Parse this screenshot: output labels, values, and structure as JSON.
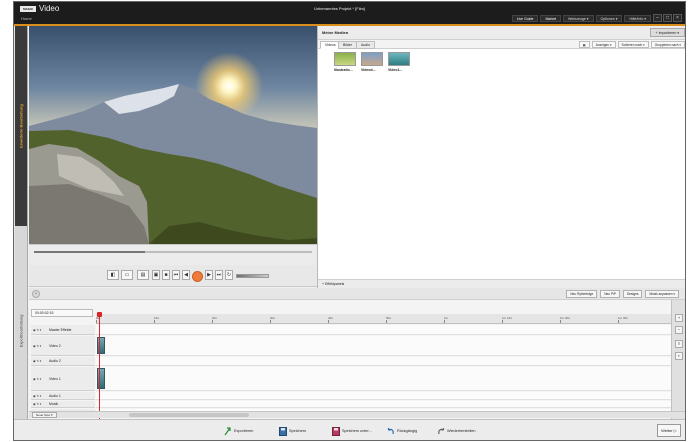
{
  "titlebar": {
    "logo": "MAGIX",
    "app_name": "Video",
    "home": "Home",
    "doc_title": "Unbenanntes Projekt * [Film]",
    "buttons": [
      "Live Guide",
      "Market",
      "Werkzeuge ▾",
      "Optionen ▾",
      "Hilfe/Info ▾"
    ],
    "window_controls": [
      "–",
      "□",
      "×"
    ],
    "accent_color": "#d98e1a"
  },
  "left_tabs": {
    "active": "Erweiterte Bearbeitung",
    "second": "Exportbearbeitung"
  },
  "preview": {
    "progress": 0.4
  },
  "media_pool": {
    "title": "Meine Medien",
    "import_label": "+ Importieren ▾",
    "tabs": [
      "Videos",
      "Bilder",
      "Audio"
    ],
    "tools": [
      "Anzeigen ▾",
      "Sortieren nach ▾",
      "Gruppieren nach ▾"
    ],
    "items": [
      {
        "label": "Illustratio..."
      },
      {
        "label": "Videod..."
      },
      {
        "label": "Video1..."
      }
    ],
    "footer": "+ Effektpanels"
  },
  "timeline_toolbar": {
    "tools": [
      "Neu Rythmfolge",
      "Neu PiP",
      "Designs",
      "Musik anpassen ▾"
    ]
  },
  "timeline": {
    "timecode": "00:00:02:15",
    "ruler_ticks": [
      "0s",
      "10s",
      "20s",
      "30s",
      "40s",
      "50s",
      "1m",
      "1m 10s",
      "1m 20s",
      "1m 30s",
      "1m 40s"
    ],
    "tracks": [
      {
        "name": "Master Effekte"
      },
      {
        "name": "Video 2"
      },
      {
        "name": "Audio 2"
      },
      {
        "name": "Video 1"
      },
      {
        "name": "Audio 1"
      },
      {
        "name": "Musik"
      },
      {
        "name": "Sprache"
      }
    ],
    "new_track": "Neue Spur ▾"
  },
  "actionbar": {
    "actions": [
      {
        "label": "Exportieren",
        "icon": "export-icon"
      },
      {
        "label": "Speichern",
        "icon": "save-icon"
      },
      {
        "label": "Speichern unter...",
        "icon": "save-as-icon"
      },
      {
        "label": "Rückgängig",
        "icon": "undo-icon"
      },
      {
        "label": "Wiederherstellen",
        "icon": "redo-icon"
      }
    ],
    "next": "Weiter ▷"
  }
}
